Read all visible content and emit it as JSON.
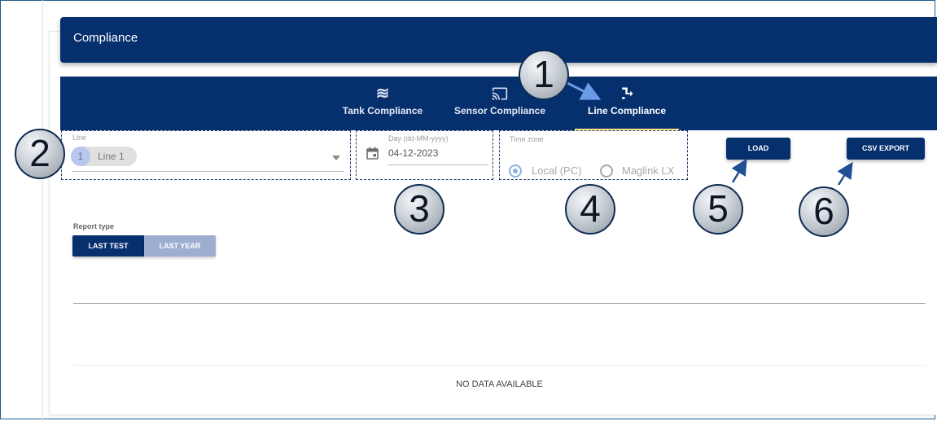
{
  "page": {
    "title": "Compliance"
  },
  "tabs": [
    {
      "label": "Tank Compliance",
      "icon": "waves-icon",
      "glyph": "≋",
      "active": false
    },
    {
      "label": "Sensor Compliance",
      "icon": "cast-icon",
      "glyph": "",
      "active": false
    },
    {
      "label": "Line Compliance",
      "icon": "line-route-icon",
      "glyph": "",
      "active": true
    }
  ],
  "filters": {
    "line": {
      "label": "Line",
      "chip_number": "1",
      "chip_text": "Line 1"
    },
    "day": {
      "label": "Day (dd-MM-yyyy)",
      "value": "04-12-2023"
    },
    "timezone": {
      "label": "Time zone",
      "options": [
        {
          "label": "Local (PC)",
          "selected": true
        },
        {
          "label": "Maglink LX",
          "selected": false
        }
      ]
    }
  },
  "buttons": {
    "load": "LOAD",
    "csv_export": "CSV EXPORT"
  },
  "report_type": {
    "label": "Report type",
    "options": [
      {
        "label": "LAST TEST",
        "selected": true
      },
      {
        "label": "LAST YEAR",
        "selected": false
      }
    ]
  },
  "table": {
    "empty_text": "NO DATA AVAILABLE"
  },
  "callouts": [
    "1",
    "2",
    "3",
    "4",
    "5",
    "6"
  ],
  "colors": {
    "primary": "#062f6e",
    "tab_indicator": "#ffe082",
    "callout_arrow": "#5b8fe0",
    "dashed_outline": "#1f3d6e"
  }
}
